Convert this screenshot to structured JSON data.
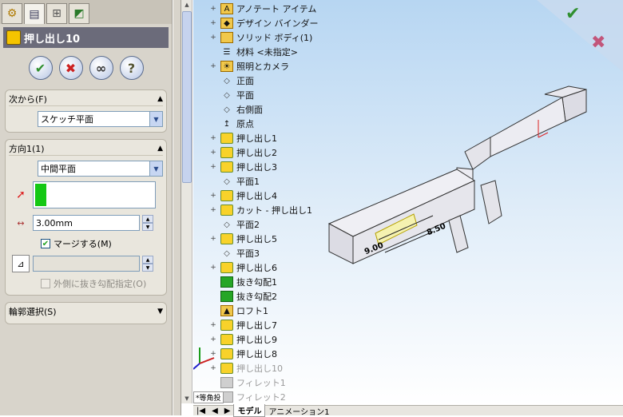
{
  "property_manager": {
    "tabs": [
      "feature-manager-tab",
      "property-manager-tab",
      "configuration-manager-tab",
      "display-manager-tab"
    ],
    "title": "押し出し10",
    "buttons": {
      "ok": "✔",
      "cancel": "✖",
      "preview": "∞",
      "help": "?"
    },
    "from_group": {
      "title": "次から(F)",
      "value": "スケッチ平面"
    },
    "direction_group": {
      "title": "方向1(1)",
      "end_condition": "中間平面",
      "depth": "3.00mm",
      "merge_label": "マージする(M)",
      "draft_outward_label": "外側に抜き勾配指定(O)"
    },
    "contour_group": {
      "title": "輪郭選択(S)"
    }
  },
  "tree": {
    "items": [
      {
        "label": "アノテート アイテム",
        "sign": "+",
        "icon": "annotation-icon"
      },
      {
        "label": "デザイン バインダー",
        "sign": "+",
        "icon": "binder-icon"
      },
      {
        "label": "ソリッド ボディ(1)",
        "sign": "+",
        "icon": "solid-body-icon"
      },
      {
        "label": "材料 <未指定>",
        "sign": "",
        "icon": "material-icon"
      },
      {
        "label": "照明とカメラ",
        "sign": "+",
        "icon": "lights-icon"
      },
      {
        "label": "正面",
        "sign": "",
        "icon": "plane-icon"
      },
      {
        "label": "平面",
        "sign": "",
        "icon": "plane-icon"
      },
      {
        "label": "右側面",
        "sign": "",
        "icon": "plane-icon"
      },
      {
        "label": "原点",
        "sign": "",
        "icon": "origin-icon"
      },
      {
        "label": "押し出し1",
        "sign": "+",
        "icon": "extrude-icon"
      },
      {
        "label": "押し出し2",
        "sign": "+",
        "icon": "extrude-icon"
      },
      {
        "label": "押し出し3",
        "sign": "+",
        "icon": "extrude-icon"
      },
      {
        "label": "平面1",
        "sign": "",
        "icon": "plane-icon"
      },
      {
        "label": "押し出し4",
        "sign": "+",
        "icon": "extrude-icon"
      },
      {
        "label": "カット - 押し出し1",
        "sign": "+",
        "icon": "cut-extrude-icon"
      },
      {
        "label": "平面2",
        "sign": "",
        "icon": "plane-icon"
      },
      {
        "label": "押し出し5",
        "sign": "+",
        "icon": "extrude-icon"
      },
      {
        "label": "平面3",
        "sign": "",
        "icon": "plane-icon"
      },
      {
        "label": "押し出し6",
        "sign": "+",
        "icon": "extrude-icon"
      },
      {
        "label": "抜き勾配1",
        "sign": "",
        "icon": "draft-icon"
      },
      {
        "label": "抜き勾配2",
        "sign": "",
        "icon": "draft-icon"
      },
      {
        "label": "ロフト1",
        "sign": "",
        "icon": "loft-icon"
      },
      {
        "label": "押し出し7",
        "sign": "+",
        "icon": "extrude-icon"
      },
      {
        "label": "押し出し9",
        "sign": "+",
        "icon": "extrude-icon"
      },
      {
        "label": "押し出し8",
        "sign": "+",
        "icon": "extrude-icon"
      },
      {
        "label": "押し出し10",
        "sign": "+",
        "icon": "extrude-icon",
        "dim": true
      },
      {
        "label": "フィレット1",
        "sign": "",
        "icon": "fillet-icon",
        "dim": true
      },
      {
        "label": "フィレット2",
        "sign": "",
        "icon": "fillet-icon",
        "dim": true
      }
    ]
  },
  "viewport": {
    "view_label": "*等角投",
    "dimension_labels": [
      "8.50",
      "9.00"
    ],
    "bottom_tabs": [
      "モデル",
      "アニメーション1"
    ]
  },
  "colors": {
    "pm_header": "#6b6b7a",
    "ok_green": "#2f8f2f",
    "cancel_red": "#c22",
    "viewport_top": "#b7d6f2"
  }
}
